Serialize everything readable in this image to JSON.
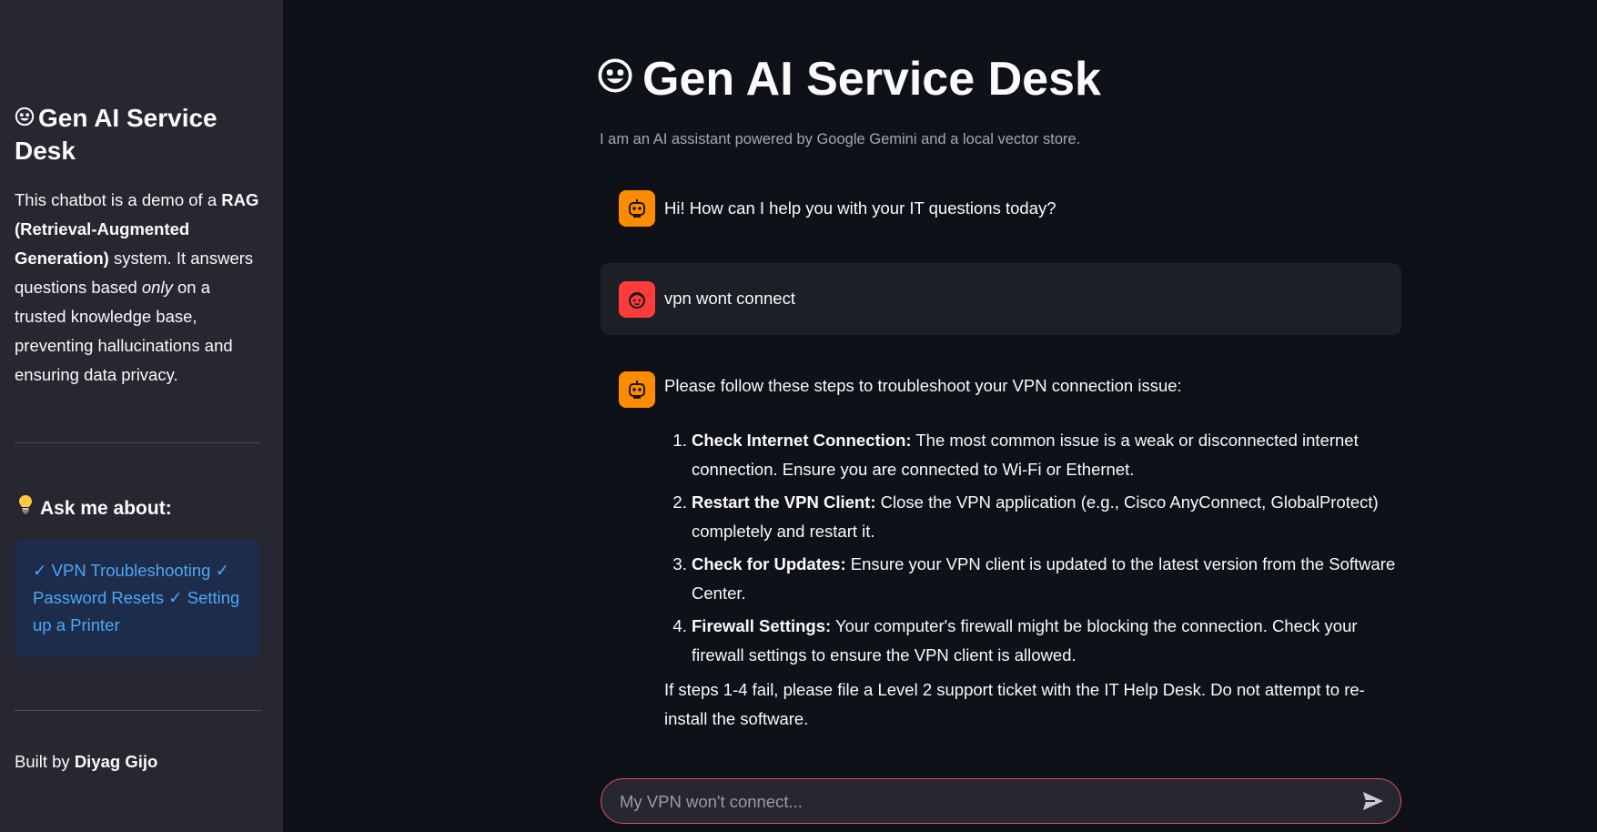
{
  "sidebar": {
    "title": "Gen AI Service Desk",
    "description": {
      "p1": "This chatbot is a demo of a ",
      "b1": "RAG (Retrieval-Augmented Generation)",
      "p2": " system. It answers questions based ",
      "i1": "only",
      "p3": " on a trusted knowledge base, preventing hallucinations and ensuring data privacy."
    },
    "ask_heading": "Ask me about:",
    "topics": "✓ VPN Troubleshooting ✓ Password Resets ✓ Setting up a Printer",
    "built_by_prefix": "Built by ",
    "built_by_name": "Diyag Gijo"
  },
  "main": {
    "title": "Gen AI Service Desk",
    "subtitle": "I am an AI assistant powered by Google Gemini and a local vector store."
  },
  "messages": {
    "greeting": "Hi! How can I help you with your IT questions today?",
    "user": "vpn wont connect",
    "answer_intro": "Please follow these steps to troubleshoot your VPN connection issue:",
    "steps": [
      {
        "bold": "Check Internet Connection:",
        "text": " The most common issue is a weak or disconnected internet connection. Ensure you are connected to Wi-Fi or Ethernet."
      },
      {
        "bold": "Restart the VPN Client:",
        "text": " Close the VPN application (e.g., Cisco AnyConnect, GlobalProtect) completely and restart it."
      },
      {
        "bold": "Check for Updates:",
        "text": " Ensure your VPN client is updated to the latest version from the Software Center."
      },
      {
        "bold": "Firewall Settings:",
        "text": " Your computer's firewall might be blocking the connection. Check your firewall settings to ensure the VPN client is allowed."
      }
    ],
    "closing": "If steps 1-4 fail, please file a Level 2 support ticket with the IT Help Desk. Do not attempt to re-install the software."
  },
  "input": {
    "placeholder": "My VPN won't connect..."
  },
  "icons": {
    "title": "grinning-face-icon",
    "bot_avatar": "robot-icon",
    "user_avatar": "user-face-icon",
    "bulb": "lightbulb-icon",
    "send": "send-icon"
  },
  "colors": {
    "accent_orange": "#ff8c00",
    "user_red": "#ff3b3b",
    "link_blue": "#4ea7f5",
    "input_border": "#e04f5a"
  }
}
